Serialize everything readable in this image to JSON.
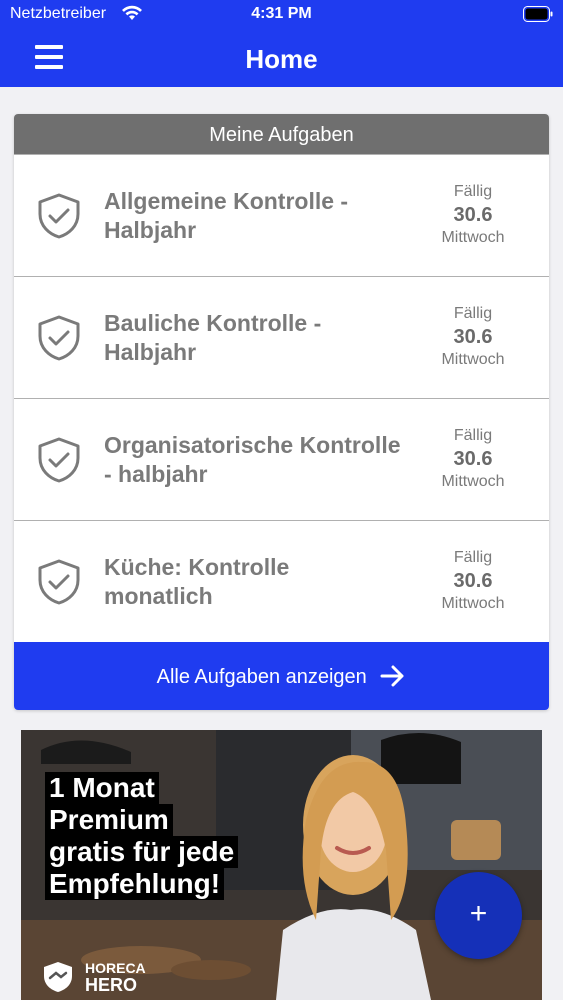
{
  "status_bar": {
    "carrier": "Netzbetreiber",
    "time": "4:31 PM"
  },
  "header": {
    "title": "Home"
  },
  "tasks": {
    "heading": "Meine Aufgaben",
    "items": [
      {
        "title": "Allgemeine Kontrolle - Halbjahr",
        "due_label": "Fällig",
        "due_date": "30.6",
        "due_weekday": "Mittwoch"
      },
      {
        "title": "Bauliche Kontrolle - Halbjahr",
        "due_label": "Fällig",
        "due_date": "30.6",
        "due_weekday": "Mittwoch"
      },
      {
        "title": "Organisatorische Kontrolle - halbjahr",
        "due_label": "Fällig",
        "due_date": "30.6",
        "due_weekday": "Mittwoch"
      },
      {
        "title": "Küche: Kontrolle monatlich",
        "due_label": "Fällig",
        "due_date": "30.6",
        "due_weekday": "Mittwoch"
      }
    ],
    "show_all_label": "Alle Aufgaben anzeigen"
  },
  "promo": {
    "lines": [
      "1 Monat",
      "Premium",
      "gratis für jede",
      "Empfehlung!"
    ],
    "logo_line1": "HORECA",
    "logo_line2": "HERO"
  },
  "fab": {
    "label": "+"
  },
  "colors": {
    "accent": "#1f3cf0",
    "card_header": "#6f6f6f",
    "fab": "#1530b8"
  }
}
